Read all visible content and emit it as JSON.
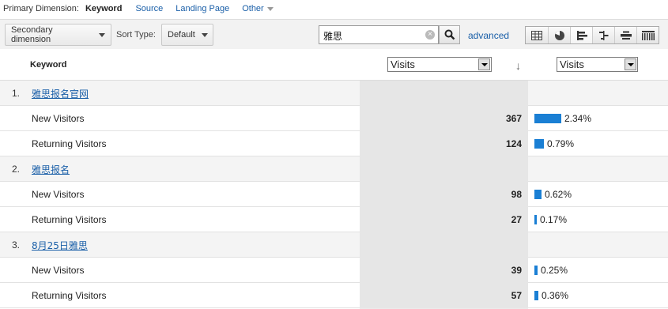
{
  "dimension_bar": {
    "label": "Primary Dimension:",
    "active": "Keyword",
    "links": [
      "Source",
      "Landing Page"
    ],
    "other": "Other"
  },
  "toolbar": {
    "secondary_dimension": "Secondary dimension",
    "sort_type_label": "Sort Type:",
    "sort_type_value": "Default",
    "search_value": "雅思",
    "advanced": "advanced",
    "views": [
      "table-view-icon",
      "pie-view-icon",
      "performance-view-icon",
      "comparison-view-icon",
      "term-cloud-view-icon",
      "pivot-view-icon"
    ]
  },
  "table": {
    "header": {
      "keyword": "Keyword",
      "metric1": "Visits",
      "sort_indicator": "↓",
      "metric2": "Visits"
    },
    "bar_color": "#1a7fd4",
    "groups": [
      {
        "num": "1.",
        "name": "雅思报名官网",
        "rows": [
          {
            "label": "New Visitors",
            "value": "367",
            "percent": "2.34%",
            "fraction": 0.0234
          },
          {
            "label": "Returning Visitors",
            "value": "124",
            "percent": "0.79%",
            "fraction": 0.0079
          }
        ]
      },
      {
        "num": "2.",
        "name": "雅思报名",
        "rows": [
          {
            "label": "New Visitors",
            "value": "98",
            "percent": "0.62%",
            "fraction": 0.0062
          },
          {
            "label": "Returning Visitors",
            "value": "27",
            "percent": "0.17%",
            "fraction": 0.0017
          }
        ]
      },
      {
        "num": "3.",
        "name": "8月25日雅思",
        "rows": [
          {
            "label": "New Visitors",
            "value": "39",
            "percent": "0.25%",
            "fraction": 0.0025
          },
          {
            "label": "Returning Visitors",
            "value": "57",
            "percent": "0.36%",
            "fraction": 0.0036
          }
        ]
      }
    ]
  }
}
